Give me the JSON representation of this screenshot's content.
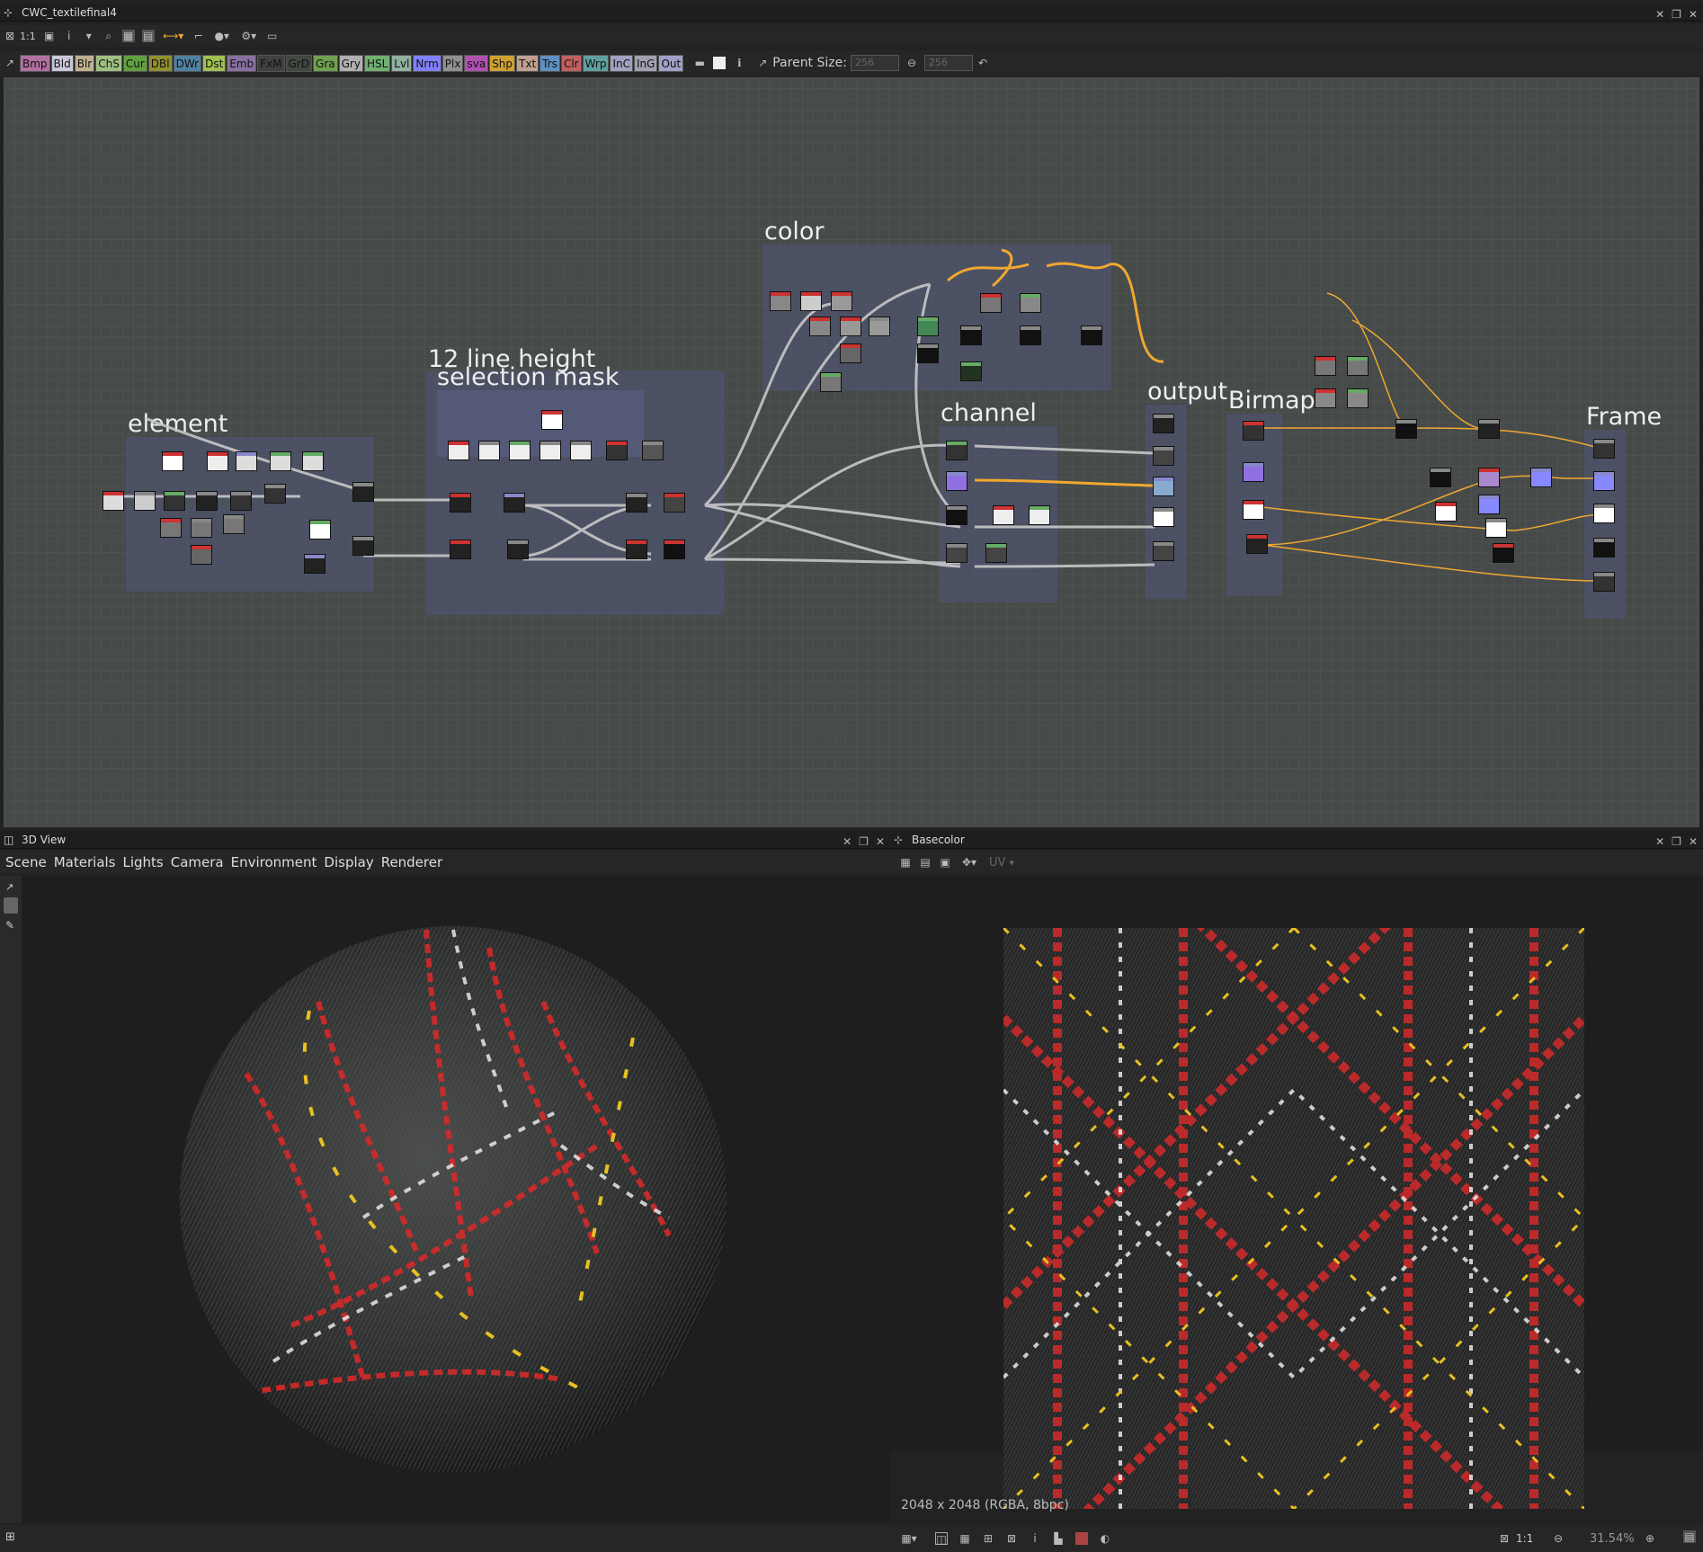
{
  "graph_window": {
    "title": "CWC_textilefinal4",
    "toolbar_one_to_one": "1:1",
    "node_chips": [
      {
        "label": "Bmp",
        "color": "#b070a0"
      },
      {
        "label": "Bld",
        "color": "#c8c8d8"
      },
      {
        "label": "Blr",
        "color": "#c0b090"
      },
      {
        "label": "ChS",
        "color": "#a0c080"
      },
      {
        "label": "Cur",
        "color": "#60a040"
      },
      {
        "label": "DBl",
        "color": "#909030"
      },
      {
        "label": "DWr",
        "color": "#5080a0"
      },
      {
        "label": "Dst",
        "color": "#a0c050"
      },
      {
        "label": "Emb",
        "color": "#8870a0"
      },
      {
        "label": "FxM",
        "color": "#404040"
      },
      {
        "label": "GrD",
        "color": "#404840"
      },
      {
        "label": "Gra",
        "color": "#70a050"
      },
      {
        "label": "Gry",
        "color": "#b0b0b0"
      },
      {
        "label": "HSL",
        "color": "#70b070"
      },
      {
        "label": "Lvl",
        "color": "#90b0a0"
      },
      {
        "label": "Nrm",
        "color": "#8080ff"
      },
      {
        "label": "Plx",
        "color": "#909090"
      },
      {
        "label": "sva",
        "color": "#b050b0"
      },
      {
        "label": "Shp",
        "color": "#d0a030"
      },
      {
        "label": "Txt",
        "color": "#c0a090"
      },
      {
        "label": "Trs",
        "color": "#6090c0"
      },
      {
        "label": "Clr",
        "color": "#c06060"
      },
      {
        "label": "Wrp",
        "color": "#60a0a0"
      },
      {
        "label": "InC",
        "color": "#a0a0c0"
      },
      {
        "label": "InG",
        "color": "#a0a0b0"
      },
      {
        "label": "Out",
        "color": "#a0a0c8"
      }
    ],
    "parent_size_label": "Parent Size:",
    "parent_size_w": "256",
    "parent_size_h": "256",
    "frames": {
      "element": "element",
      "line_height": "12 line height",
      "selection_mask": "selection mask",
      "color": "color",
      "channel": "channel",
      "output": "output",
      "birmap": "Birmap",
      "frame": "Frame"
    }
  },
  "view3d": {
    "title": "3D View",
    "menu": [
      "Scene",
      "Materials",
      "Lights",
      "Camera",
      "Environment",
      "Display",
      "Renderer"
    ]
  },
  "view2d": {
    "title": "Basecolor",
    "uv_label": "UV",
    "resolution": "2048 x 2048 (RGBA, 8bpc)",
    "ratio": "1:1",
    "zoom": "31.54%"
  },
  "colors": {
    "wire_active": "#f0a830",
    "wire_normal": "#c8c8c8",
    "fabric_red": "#d42a2a",
    "fabric_yellow": "#e8c020",
    "fabric_white": "#e8e8e8"
  }
}
